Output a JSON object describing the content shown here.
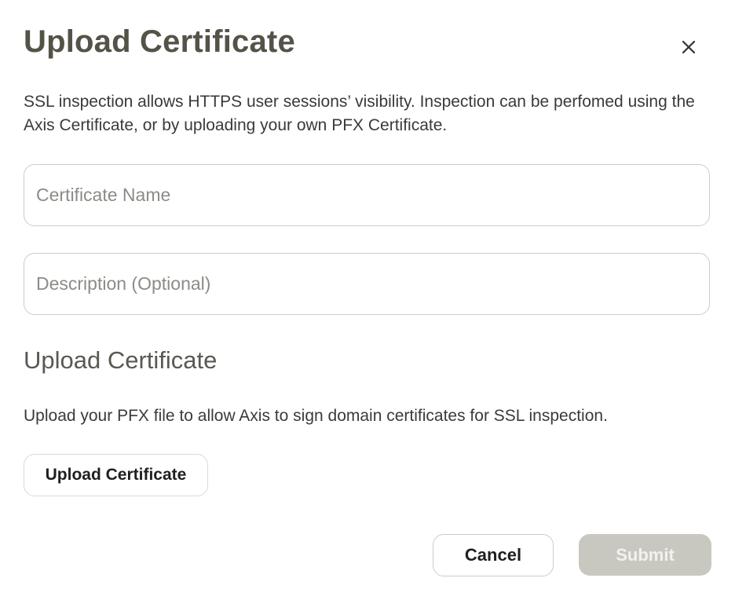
{
  "dialog": {
    "title": "Upload Certificate",
    "close_icon": "close-icon",
    "intro": "SSL inspection allows HTTPS user sessions’ visibility. Inspection can be perfomed using the Axis Certificate, or by uploading your own PFX Certificate."
  },
  "form": {
    "certificate_name": {
      "value": "",
      "placeholder": "Certificate Name"
    },
    "description": {
      "value": "",
      "placeholder": "Description (Optional)"
    }
  },
  "upload": {
    "heading": "Upload Certificate",
    "text": "Upload your PFX file to allow Axis to sign domain certificates for SSL inspection.",
    "button_label": "Upload Certificate"
  },
  "footer": {
    "cancel_label": "Cancel",
    "submit_label": "Submit",
    "submit_disabled": true
  },
  "colors": {
    "title": "#555248",
    "field_border": "#cfccc6",
    "submit_disabled_bg": "#c9c8c0"
  }
}
